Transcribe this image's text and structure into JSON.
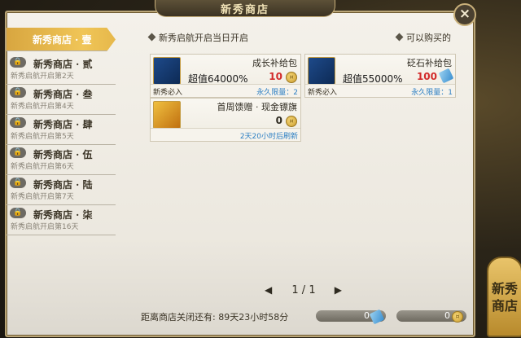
{
  "header": {
    "title": "新秀商店"
  },
  "sidebar": {
    "items": [
      {
        "label": "新秀商店 · 壹",
        "sub": "",
        "locked": false,
        "active": true
      },
      {
        "label": "新秀商店 · 贰",
        "sub": "新秀启航开启第2天",
        "locked": true
      },
      {
        "label": "新秀商店 · 叁",
        "sub": "新秀启航开启第4天",
        "locked": true
      },
      {
        "label": "新秀商店 · 肆",
        "sub": "新秀启航开启第5天",
        "locked": true
      },
      {
        "label": "新秀商店 · 伍",
        "sub": "新秀启航开启第6天",
        "locked": true
      },
      {
        "label": "新秀商店 · 陆",
        "sub": "新秀启航开启第7天",
        "locked": true
      },
      {
        "label": "新秀商店 · 柒",
        "sub": "新秀启航开启第16天",
        "locked": true
      }
    ]
  },
  "notice": {
    "left": "新秀启航开启当日开启",
    "right": "可以购买的"
  },
  "cards": [
    {
      "name": "成长补给包",
      "deal": "超值64000%",
      "price": "10",
      "currency": "coin",
      "footer_left": "新秀必入",
      "footer_right": "永久限量：2"
    },
    {
      "name": "砭石补给包",
      "deal": "超值55000%",
      "price": "100",
      "currency": "coupon",
      "footer_left": "新秀必入",
      "footer_right": "永久限量：1"
    },
    {
      "name": "首周馈赠 · 现金镖旗",
      "deal": "",
      "price": "0",
      "currency": "coin",
      "footer_left": "",
      "footer_right": "2天20小时后刷新"
    }
  ],
  "pager": {
    "page": "1 / 1",
    "prev": "◀",
    "next": "▶"
  },
  "footer": {
    "close_time": "距离商店关闭还有: 89天23小时58分",
    "coupon_balance": "0",
    "coin_balance": "0"
  },
  "side_tab": {
    "line1": "新秀",
    "line2": "商店"
  },
  "close_icon": "×"
}
